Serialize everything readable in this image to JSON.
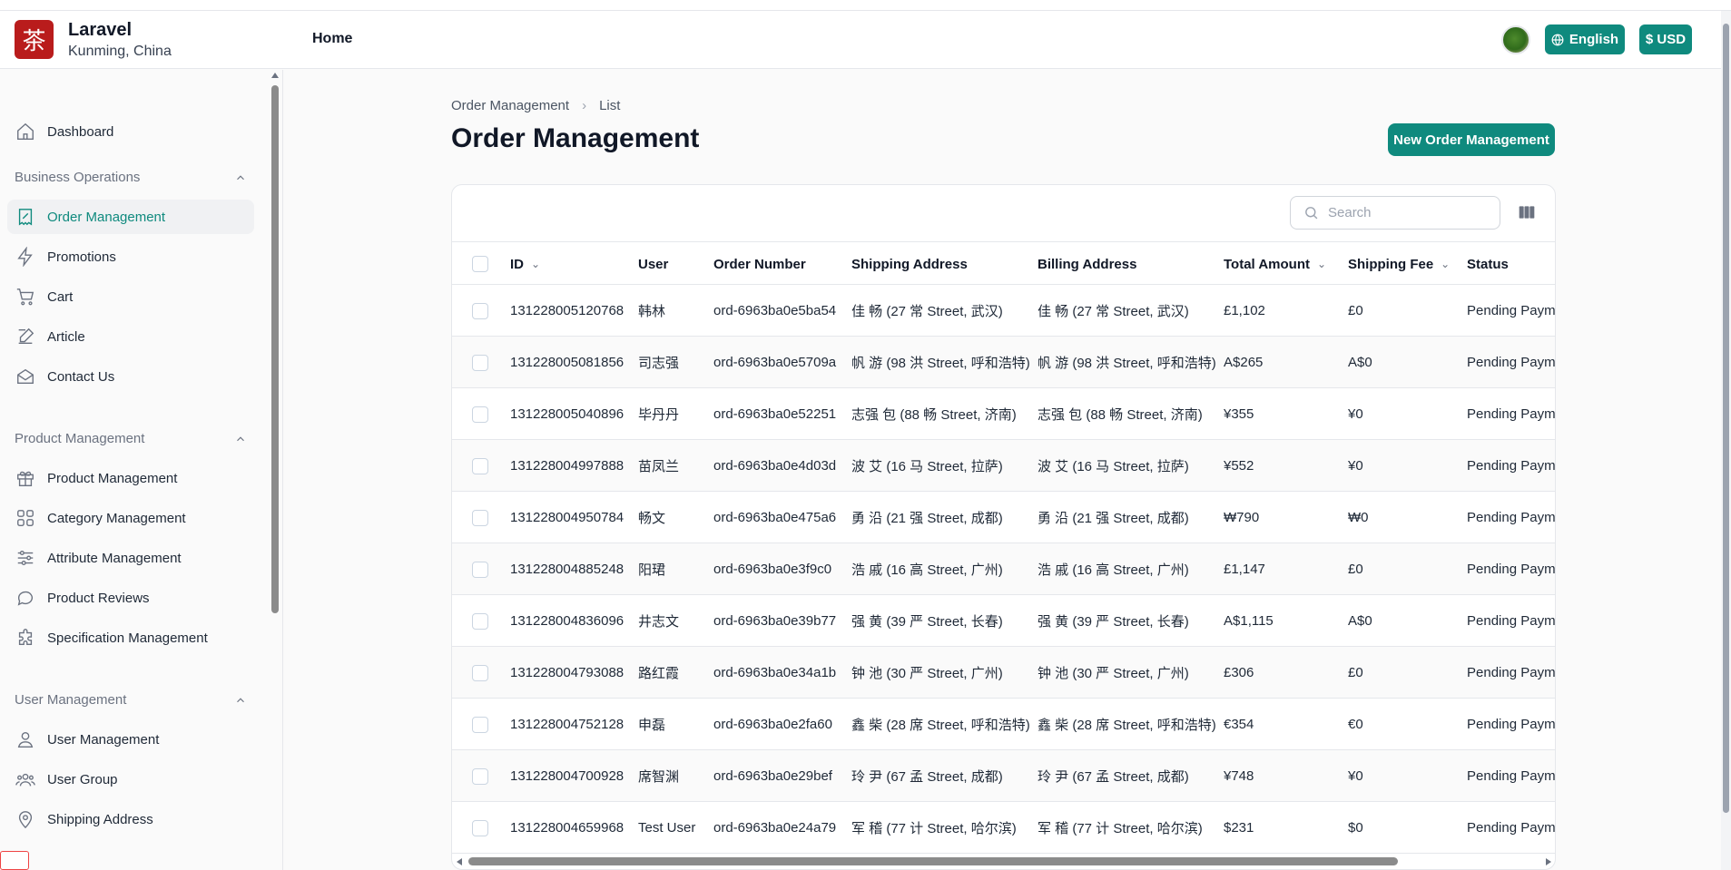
{
  "brand": {
    "logo_char": "茶",
    "name": "Laravel",
    "location": "Kunming, China",
    "logo_color": "#b91c1c"
  },
  "topnav": {
    "home": "Home"
  },
  "header_actions": {
    "language": "English",
    "currency": "$ USD",
    "accent": "#0f8a7e"
  },
  "sidebar": {
    "dashboard": "Dashboard",
    "groups": [
      {
        "title": "Business Operations",
        "items": [
          "Order Management",
          "Promotions",
          "Cart",
          "Article",
          "Contact Us"
        ]
      },
      {
        "title": "Product Management",
        "items": [
          "Product Management",
          "Category Management",
          "Attribute Management",
          "Product Reviews",
          "Specification Management"
        ]
      },
      {
        "title": "User Management",
        "items": [
          "User Management",
          "User Group",
          "Shipping Address"
        ]
      }
    ],
    "active_item": "Order Management"
  },
  "breadcrumb": {
    "parent": "Order Management",
    "separator": "›",
    "current": "List"
  },
  "page": {
    "title": "Order Management",
    "new_button": "New Order Management"
  },
  "search": {
    "placeholder": "Search"
  },
  "table": {
    "columns": [
      "ID",
      "User",
      "Order Number",
      "Shipping Address",
      "Billing Address",
      "Total Amount",
      "Shipping Fee",
      "Status"
    ],
    "rows": [
      {
        "id": "131228005120768",
        "user": "韩林",
        "order": "ord-6963ba0e5ba54",
        "ship": "佳 畅 (27 常 Street, 武汉)",
        "bill": "佳 畅 (27 常 Street, 武汉)",
        "total": "£1,102",
        "fee": "£0",
        "status": "Pending Payment"
      },
      {
        "id": "131228005081856",
        "user": "司志强",
        "order": "ord-6963ba0e5709a",
        "ship": "帆 游 (98 洪 Street, 呼和浩特)",
        "bill": "帆 游 (98 洪 Street, 呼和浩特)",
        "total": "A$265",
        "fee": "A$0",
        "status": "Pending Payment"
      },
      {
        "id": "131228005040896",
        "user": "毕丹丹",
        "order": "ord-6963ba0e52251",
        "ship": "志强 包 (88 畅 Street, 济南)",
        "bill": "志强 包 (88 畅 Street, 济南)",
        "total": "¥355",
        "fee": "¥0",
        "status": "Pending Payment"
      },
      {
        "id": "131228004997888",
        "user": "苗凤兰",
        "order": "ord-6963ba0e4d03d",
        "ship": "波 艾 (16 马 Street, 拉萨)",
        "bill": "波 艾 (16 马 Street, 拉萨)",
        "total": "¥552",
        "fee": "¥0",
        "status": "Pending Payment"
      },
      {
        "id": "131228004950784",
        "user": "畅文",
        "order": "ord-6963ba0e475a6",
        "ship": "勇 沿 (21 强 Street, 成都)",
        "bill": "勇 沿 (21 强 Street, 成都)",
        "total": "₩790",
        "fee": "₩0",
        "status": "Pending Payment"
      },
      {
        "id": "131228004885248",
        "user": "阳珺",
        "order": "ord-6963ba0e3f9c0",
        "ship": "浩 戚 (16 高 Street, 广州)",
        "bill": "浩 戚 (16 高 Street, 广州)",
        "total": "£1,147",
        "fee": "£0",
        "status": "Pending Payment"
      },
      {
        "id": "131228004836096",
        "user": "井志文",
        "order": "ord-6963ba0e39b77",
        "ship": "强 黄 (39 严 Street, 长春)",
        "bill": "强 黄 (39 严 Street, 长春)",
        "total": "A$1,115",
        "fee": "A$0",
        "status": "Pending Payment"
      },
      {
        "id": "131228004793088",
        "user": "路红霞",
        "order": "ord-6963ba0e34a1b",
        "ship": "钟 池 (30 严 Street, 广州)",
        "bill": "钟 池 (30 严 Street, 广州)",
        "total": "£306",
        "fee": "£0",
        "status": "Pending Payment"
      },
      {
        "id": "131228004752128",
        "user": "申磊",
        "order": "ord-6963ba0e2fa60",
        "ship": "鑫 柴 (28 席 Street, 呼和浩特)",
        "bill": "鑫 柴 (28 席 Street, 呼和浩特)",
        "total": "€354",
        "fee": "€0",
        "status": "Pending Payment"
      },
      {
        "id": "131228004700928",
        "user": "席智渊",
        "order": "ord-6963ba0e29bef",
        "ship": "玲 尹 (67 孟 Street, 成都)",
        "bill": "玲 尹 (67 孟 Street, 成都)",
        "total": "¥748",
        "fee": "¥0",
        "status": "Pending Payment"
      },
      {
        "id": "131228004659968",
        "user": "Test User",
        "order": "ord-6963ba0e24a79",
        "ship": "军 稽 (77 计 Street, 哈尔滨)",
        "bill": "军 稽 (77 计 Street, 哈尔滨)",
        "total": "$231",
        "fee": "$0",
        "status": "Pending Payment"
      }
    ]
  }
}
